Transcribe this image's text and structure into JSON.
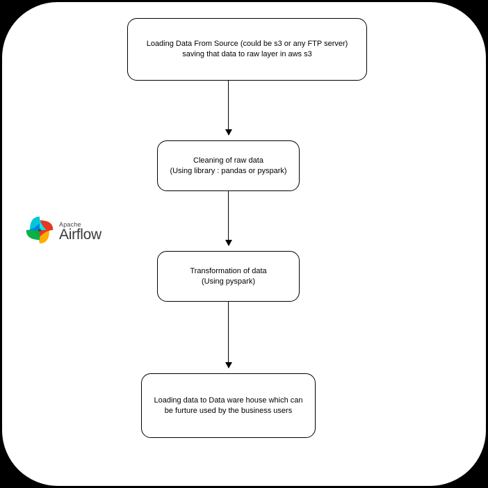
{
  "nodes": {
    "load_source": "Loading Data From Source (could be s3 or any FTP server) saving that data to raw layer in aws s3",
    "clean": "Cleaning of raw data\n(Using library : pandas or pyspark)",
    "transform": "Transformation of  data\n(Using pyspark)",
    "load_dwh": "Loading data to Data ware house which can be furture used by the business users"
  },
  "logo": {
    "apache": "Apache",
    "airflow": "Airflow"
  }
}
